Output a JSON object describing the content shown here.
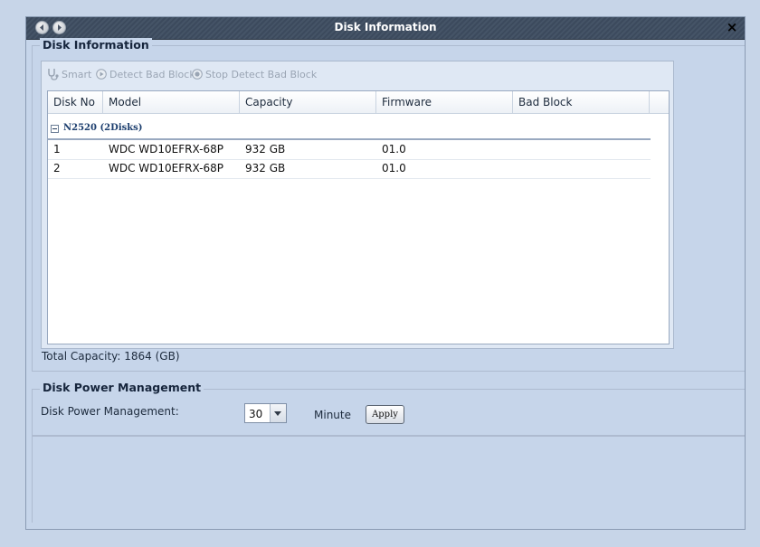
{
  "window": {
    "title": "Disk Information",
    "close_label": "×"
  },
  "disk_info": {
    "legend": "Disk Information",
    "toolbar": {
      "smart": "Smart",
      "detect_bad_block": "Detect Bad Block",
      "stop_detect_bad_block": "Stop Detect Bad Block"
    },
    "columns": [
      "Disk No",
      "Model",
      "Capacity",
      "Firmware",
      "Bad Block"
    ],
    "group_label": "N2520 (2Disks)",
    "rows": [
      {
        "disk_no": "1",
        "model": "WDC WD10EFRX-68P",
        "capacity": "932 GB",
        "firmware": "01.0",
        "bad_block": ""
      },
      {
        "disk_no": "2",
        "model": "WDC WD10EFRX-68P",
        "capacity": "932 GB",
        "firmware": "01.0",
        "bad_block": ""
      }
    ],
    "total_capacity": "Total Capacity: 1864 (GB)"
  },
  "power": {
    "legend": "Disk Power Management",
    "label": "Disk Power Management:",
    "value": "30",
    "unit": "Minute",
    "apply_label": "Apply"
  }
}
